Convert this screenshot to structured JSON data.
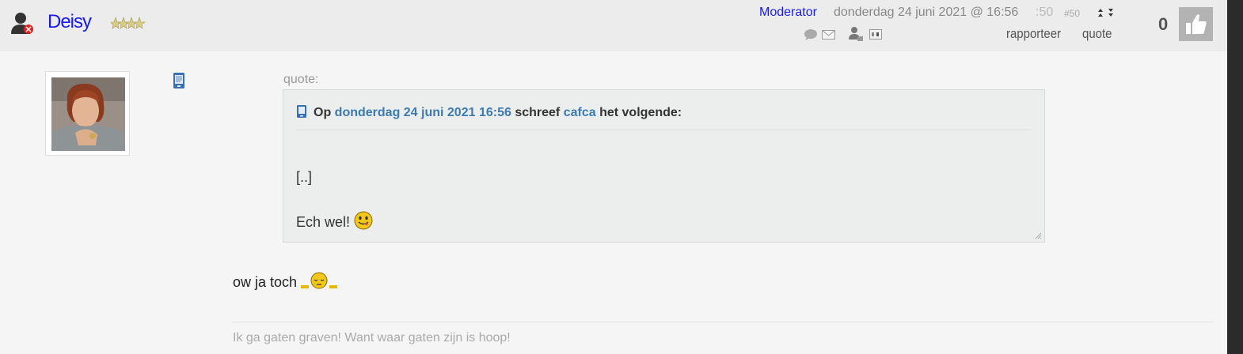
{
  "user": {
    "name": "Deisy",
    "role": "Moderator",
    "icon": "user-offline-icon",
    "rank": "rank-stars-icon"
  },
  "post": {
    "date": "donderdag 24 juni 2021 @ 16:56",
    "seconds": ":50",
    "number": "#50"
  },
  "actions": {
    "report": "rapporteer",
    "quote": "quote",
    "icons": [
      "speech-bubble-icon",
      "envelope-icon",
      "user-profile-icon",
      "id-card-icon",
      "sort-arrows-icon"
    ]
  },
  "likes": {
    "count": "0",
    "icon": "thumbs-up-icon"
  },
  "avatar": {
    "alt": "avatar"
  },
  "quote_block": {
    "label": "quote:",
    "prefix": "Op",
    "date_link": "donderdag 24 juni 2021 16:56",
    "middle": "schreef",
    "author": "cafca",
    "suffix": "het volgende:",
    "line1": "[..]",
    "line2": "Ech wel!"
  },
  "message": {
    "text": "ow ja toch"
  },
  "signature": {
    "text": "Ik ga gaten graven! Want waar gaten zijn is hoop!"
  },
  "colors": {
    "link": "#1a1ae6",
    "quote_link": "#3c7ab0",
    "header_bg": "#ececec",
    "page_bg": "#f5f5f5"
  }
}
